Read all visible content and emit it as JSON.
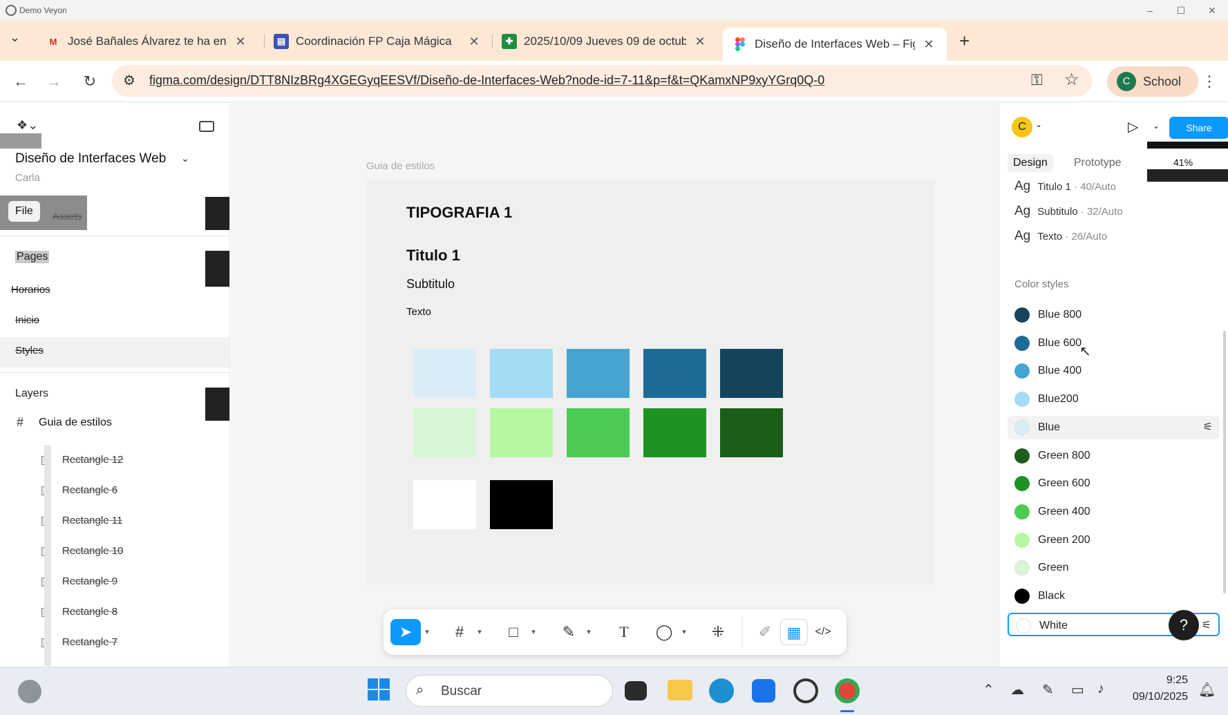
{
  "window": {
    "app_title": "Demo Veyon"
  },
  "browser": {
    "tabs": [
      {
        "label": "José Bañales Álvarez te ha envia",
        "favicon": "gmail-icon",
        "active": false
      },
      {
        "label": "Coordinación FP Caja Mágica",
        "favicon": "forms-icon",
        "active": false
      },
      {
        "label": "2025/10/09 Jueves 09 de octub",
        "favicon": "sheets-icon",
        "active": false
      },
      {
        "label": "Diseño de Interfaces Web – Figr",
        "favicon": "figma-icon",
        "active": true
      }
    ],
    "new_tab": "+",
    "url": "figma.com/design/DTT8NIzBRg4XGEGyqEESVf/Diseño-de-Interfaces-Web?node-id=7-11&p=f&t=QKamxNP9xyYGrq0Q-0",
    "profile_initial": "C",
    "profile_label": "School"
  },
  "figma_left": {
    "file_name": "Diseño de Interfaces Web",
    "owner": "Carla",
    "tabs": {
      "file": "File",
      "assets": "Assets"
    },
    "pages_title": "Pages",
    "pages": [
      "Horarios",
      "Inicio",
      "Styles"
    ],
    "layers_title": "Layers",
    "frame_layer": "Guia de estilos",
    "layers": [
      "Rectangle 12",
      "Rectangle 6",
      "Rectangle 11",
      "Rectangle 10",
      "Rectangle 9",
      "Rectangle 8",
      "Rectangle 7"
    ]
  },
  "canvas": {
    "frame_label": "Guia de estilos",
    "heading": "TIPOGRAFIA 1",
    "titulo": "Titulo 1",
    "subtitulo": "Subtitulo",
    "texto": "Texto",
    "swatch_rows": [
      [
        "#daedf7",
        "#a4dbf5",
        "#47a4d1",
        "#1f6b98",
        "#16445d"
      ],
      [
        "#d8f5d8",
        "#b6f7a2",
        "#4ccb54",
        "#209223",
        "#1b5e19"
      ],
      [
        "#ffffff",
        "#000000"
      ]
    ]
  },
  "figma_right": {
    "avatar_initial": "C",
    "share_label": "Share",
    "zoom": "41%",
    "tabs": {
      "design": "Design",
      "prototype": "Prototype"
    },
    "text_styles": [
      {
        "ag": "Ag",
        "name": "Titulo 1",
        "meta": " · 40/Auto"
      },
      {
        "ag": "Ag",
        "name": "Subtitulo",
        "meta": " · 32/Auto"
      },
      {
        "ag": "Ag",
        "name": "Texto",
        "meta": " · 26/Auto"
      }
    ],
    "color_styles_title": "Color styles",
    "color_styles": [
      {
        "name": "Blue 800",
        "color": "#16445d"
      },
      {
        "name": "Blue 600",
        "color": "#1f6b98"
      },
      {
        "name": "Blue 400",
        "color": "#47a4d1"
      },
      {
        "name": "Blue200",
        "color": "#a4dbf5"
      },
      {
        "name": "Blue",
        "color": "#daedf7"
      },
      {
        "name": "Green 800",
        "color": "#1b5e19"
      },
      {
        "name": "Green 600",
        "color": "#209223"
      },
      {
        "name": "Green 400",
        "color": "#4ccb54"
      },
      {
        "name": "Green 200",
        "color": "#b6f7a2"
      },
      {
        "name": "Green",
        "color": "#d8f5d8"
      },
      {
        "name": "Black",
        "color": "#000000"
      },
      {
        "name": "White",
        "color": "#ffffff"
      }
    ],
    "help": "?"
  },
  "taskbar": {
    "search_placeholder": "Buscar",
    "time": "9:25",
    "date": "09/10/2025"
  }
}
